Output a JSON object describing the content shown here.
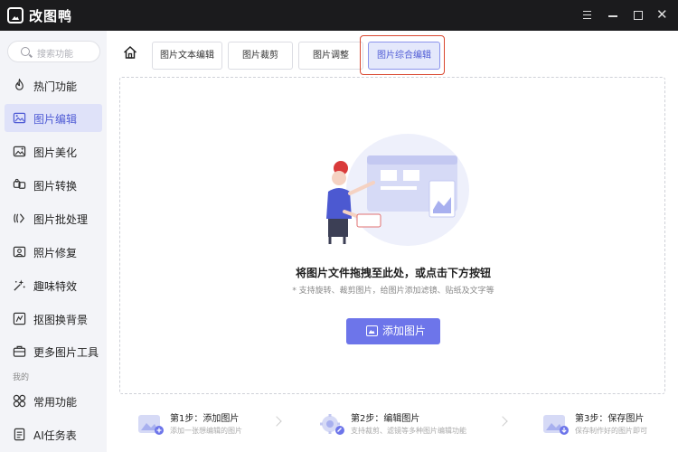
{
  "app": {
    "title": "改图鸭"
  },
  "window_controls": [
    "menu-icon",
    "minimize-icon",
    "maximize-icon",
    "close-icon"
  ],
  "sidebar": {
    "search_placeholder": "搜索功能",
    "items": [
      {
        "label": "热门功能",
        "icon": "flame-icon",
        "active": false
      },
      {
        "label": "图片编辑",
        "icon": "image-edit-icon",
        "active": true
      },
      {
        "label": "图片美化",
        "icon": "image-beautify-icon",
        "active": false
      },
      {
        "label": "图片转换",
        "icon": "convert-icon",
        "active": false
      },
      {
        "label": "图片批处理",
        "icon": "batch-icon",
        "active": false
      },
      {
        "label": "照片修复",
        "icon": "photo-repair-icon",
        "active": false
      },
      {
        "label": "趣味特效",
        "icon": "sparkle-icon",
        "active": false
      },
      {
        "label": "抠图换背景",
        "icon": "cutout-icon",
        "active": false
      },
      {
        "label": "更多图片工具",
        "icon": "toolbox-icon",
        "active": false
      }
    ],
    "section_label": "我的",
    "my_items": [
      {
        "label": "常用功能",
        "icon": "grid-icon"
      },
      {
        "label": "AI任务表",
        "icon": "task-list-icon"
      }
    ]
  },
  "tabs": [
    {
      "label": "图片文本编辑",
      "active": false
    },
    {
      "label": "图片裁剪",
      "active": false
    },
    {
      "label": "图片调整",
      "active": false
    },
    {
      "label": "图片综合编辑",
      "active": true
    }
  ],
  "dropzone": {
    "title": "将图片文件拖拽至此处，或点击下方按钮",
    "subtitle": "* 支持旋转、裁剪图片，给图片添加滤镜、贴纸及文字等",
    "button_label": "添加图片"
  },
  "steps": [
    {
      "title": "第1步：添加图片",
      "desc": "添加一张想编辑的图片"
    },
    {
      "title": "第2步：编辑图片",
      "desc": "支持裁剪、滤镜等多种图片编辑功能"
    },
    {
      "title": "第3步：保存图片",
      "desc": "保存制作好的图片即可"
    }
  ],
  "colors": {
    "accent": "#6d75ea",
    "active_bg": "#dfe2f9",
    "highlight_border": "#d9472f",
    "titlebar": "#1b1b1d"
  }
}
